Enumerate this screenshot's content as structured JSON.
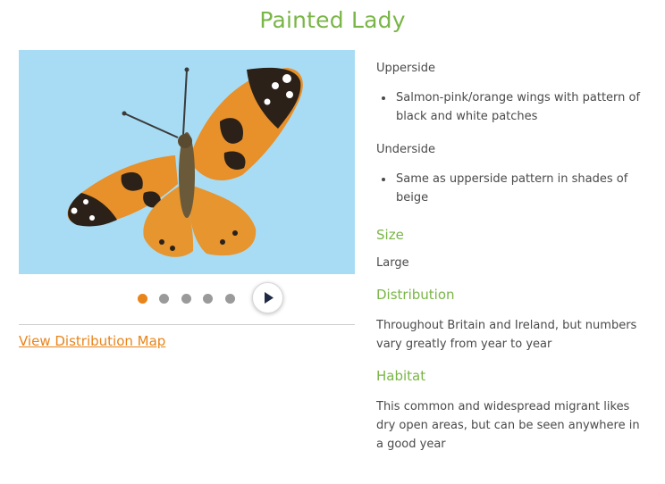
{
  "page": {
    "title": "Painted Lady"
  },
  "gallery": {
    "image_alt": "Painted Lady butterfly",
    "slide_count": 5,
    "active_slide": 1,
    "colors": {
      "active_dot": "#e8841a",
      "dot": "#9a9a9a",
      "background": "#a8dcf4"
    },
    "play_icon": "play-icon"
  },
  "links": {
    "distribution_map": "View Distribution Map"
  },
  "details": {
    "upperside_label": "Upperside",
    "upperside_items": [
      "Salmon-pink/orange wings with pattern of black and white patches"
    ],
    "underside_label": "Underside",
    "underside_items": [
      "Same as upperside pattern in shades of beige"
    ],
    "size_heading": "Size",
    "size_value": "Large",
    "distribution_heading": "Distribution",
    "distribution_text": "Throughout Britain and Ireland, but numbers vary greatly from year to year",
    "habitat_heading": "Habitat",
    "habitat_text": "This common and widespread migrant likes dry open areas, but can be seen anywhere in a good year"
  },
  "theme": {
    "heading_color": "#7ab547",
    "link_color": "#e8841a",
    "text_color": "#4a4a4a"
  }
}
